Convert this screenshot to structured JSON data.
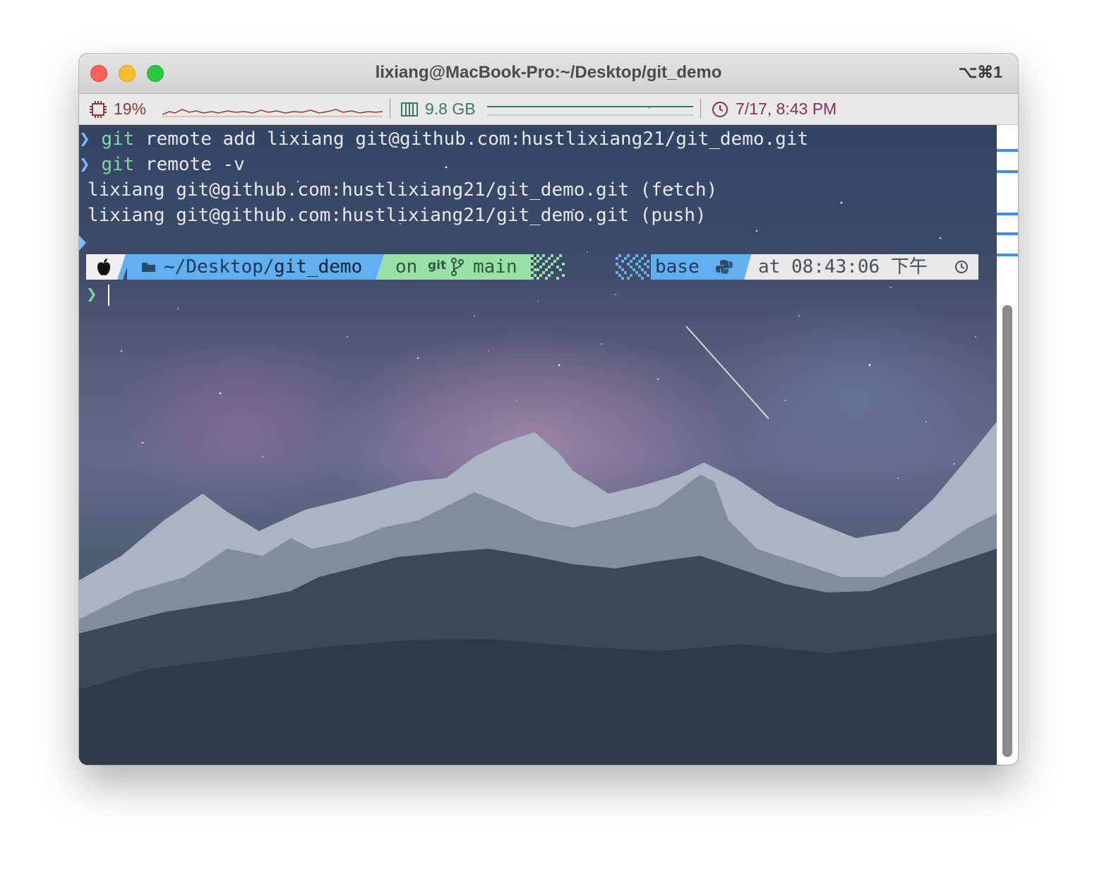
{
  "window": {
    "title": "lixiang@MacBook-Pro:~/Desktop/git_demo",
    "shortcut": "⌥⌘1"
  },
  "statusbar": {
    "cpu": "19%",
    "memory": "9.8 GB",
    "datetime": "7/17, 8:43 PM",
    "colors": {
      "cpu": "#8b3a3a",
      "memory": "#3d7a66",
      "clock": "#8a3050"
    }
  },
  "terminal": {
    "prompt_symbol": "❯",
    "cursor_prompt": "❯",
    "lines": [
      {
        "type": "command",
        "cmd": "git",
        "args": " remote add lixiang git@github.com:hustlixiang21/git_demo.git"
      },
      {
        "type": "command",
        "cmd": "git",
        "args": " remote -v"
      },
      {
        "type": "output",
        "text": "lixiang git@github.com:hustlixiang21/git_demo.git (fetch)"
      },
      {
        "type": "output",
        "text": "lixiang git@github.com:hustlixiang21/git_demo.git (push)"
      }
    ]
  },
  "powerline": {
    "os_icon": "apple-icon",
    "path_prefix": "~/Desktop/",
    "path_dir": "git_demo",
    "vcs_on": "on",
    "vcs_git": "git",
    "vcs_branch": "main",
    "env_name": "base",
    "time_text": "at 08:43:06 下午",
    "colors": {
      "path": "#61afef",
      "vcs": "#98e0a8",
      "env": "#61afef",
      "time": "#e8e8e8",
      "os": "#f0f0f0"
    }
  }
}
